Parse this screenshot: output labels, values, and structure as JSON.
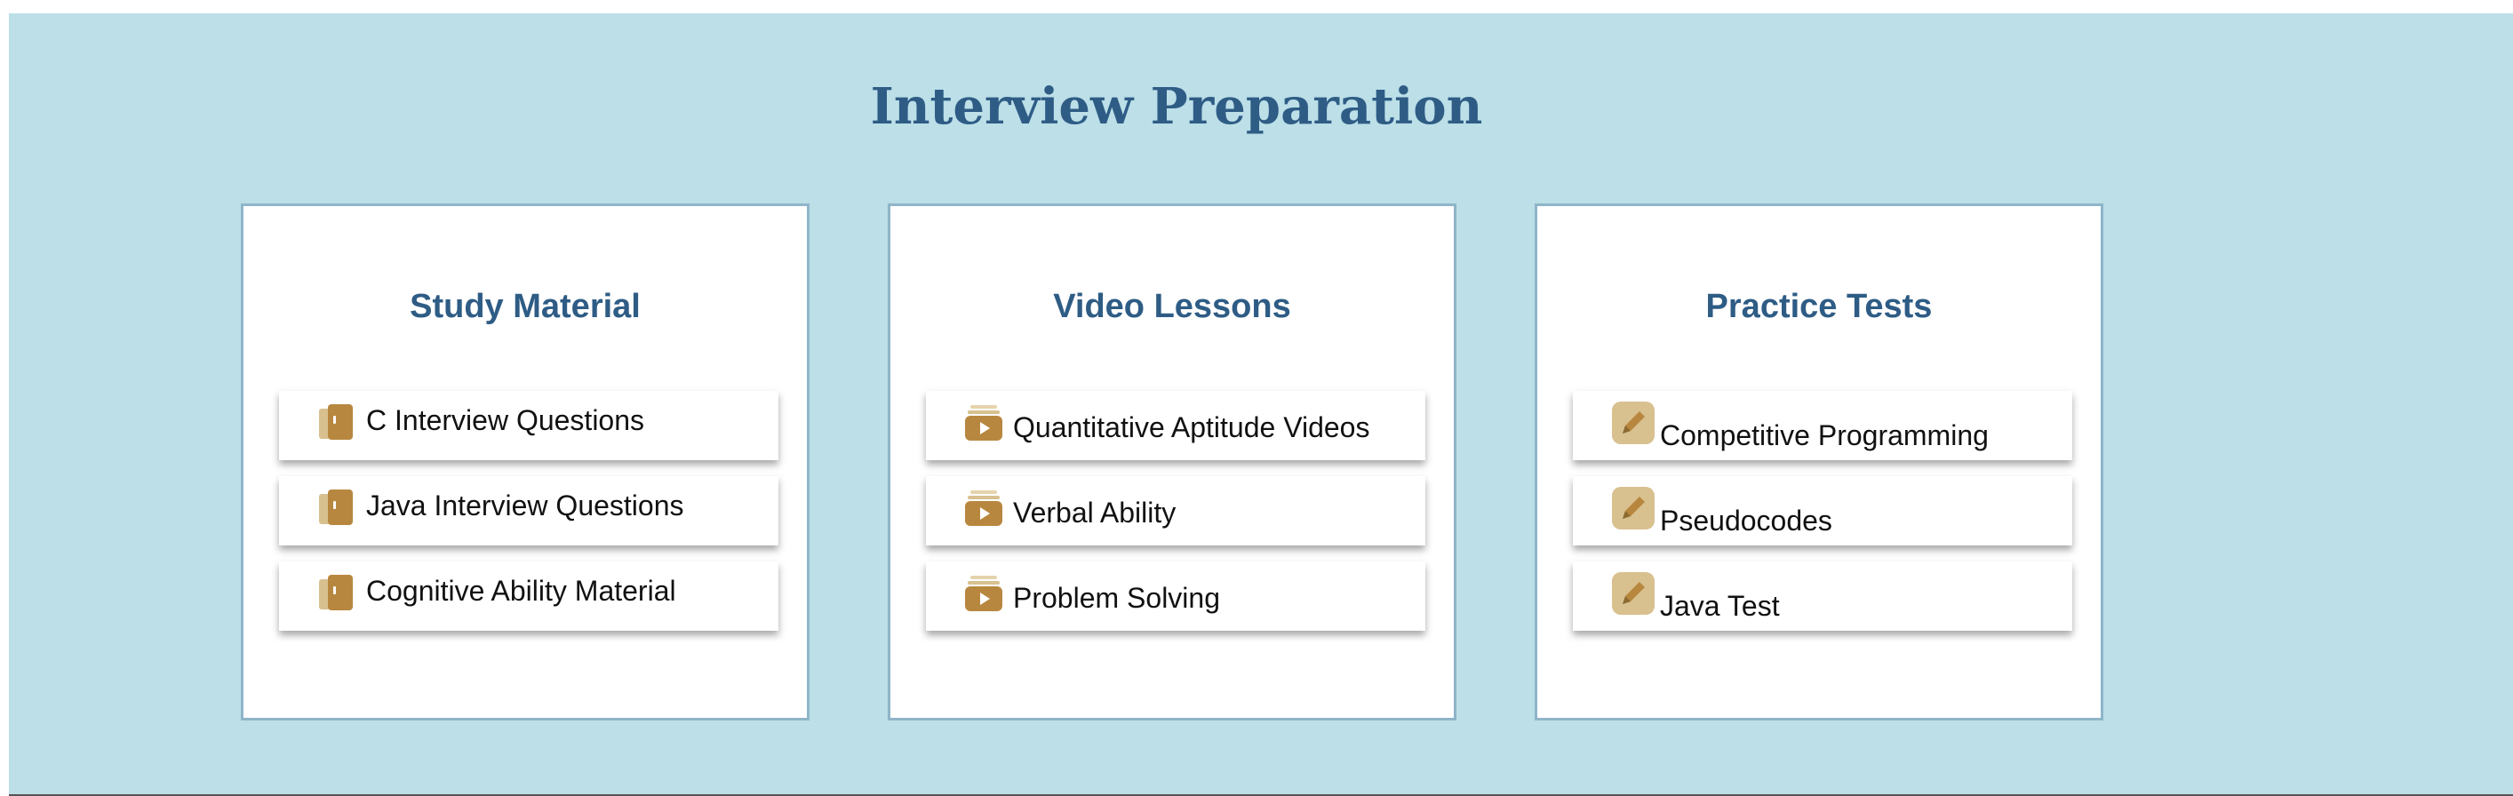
{
  "page": {
    "title": "Interview Preparation"
  },
  "colors": {
    "background": "#bcdfe8",
    "heading": "#2e5c85",
    "icon": "#b8873f",
    "icon_light": "#d8c08f"
  },
  "sections": [
    {
      "title": "Study Material",
      "icon": "book-icon",
      "items": [
        {
          "label": "C Interview Questions"
        },
        {
          "label": "Java Interview Questions"
        },
        {
          "label": "Cognitive Ability Material"
        }
      ]
    },
    {
      "title": "Video Lessons",
      "icon": "video-library-icon",
      "items": [
        {
          "label": "Quantitative Aptitude Videos"
        },
        {
          "label": "Verbal Ability"
        },
        {
          "label": "Problem Solving"
        }
      ]
    },
    {
      "title": "Practice Tests",
      "icon": "pencil-icon",
      "items": [
        {
          "label": "Competitive Programming"
        },
        {
          "label": "Pseudocodes"
        },
        {
          "label": "Java Test"
        }
      ]
    }
  ]
}
